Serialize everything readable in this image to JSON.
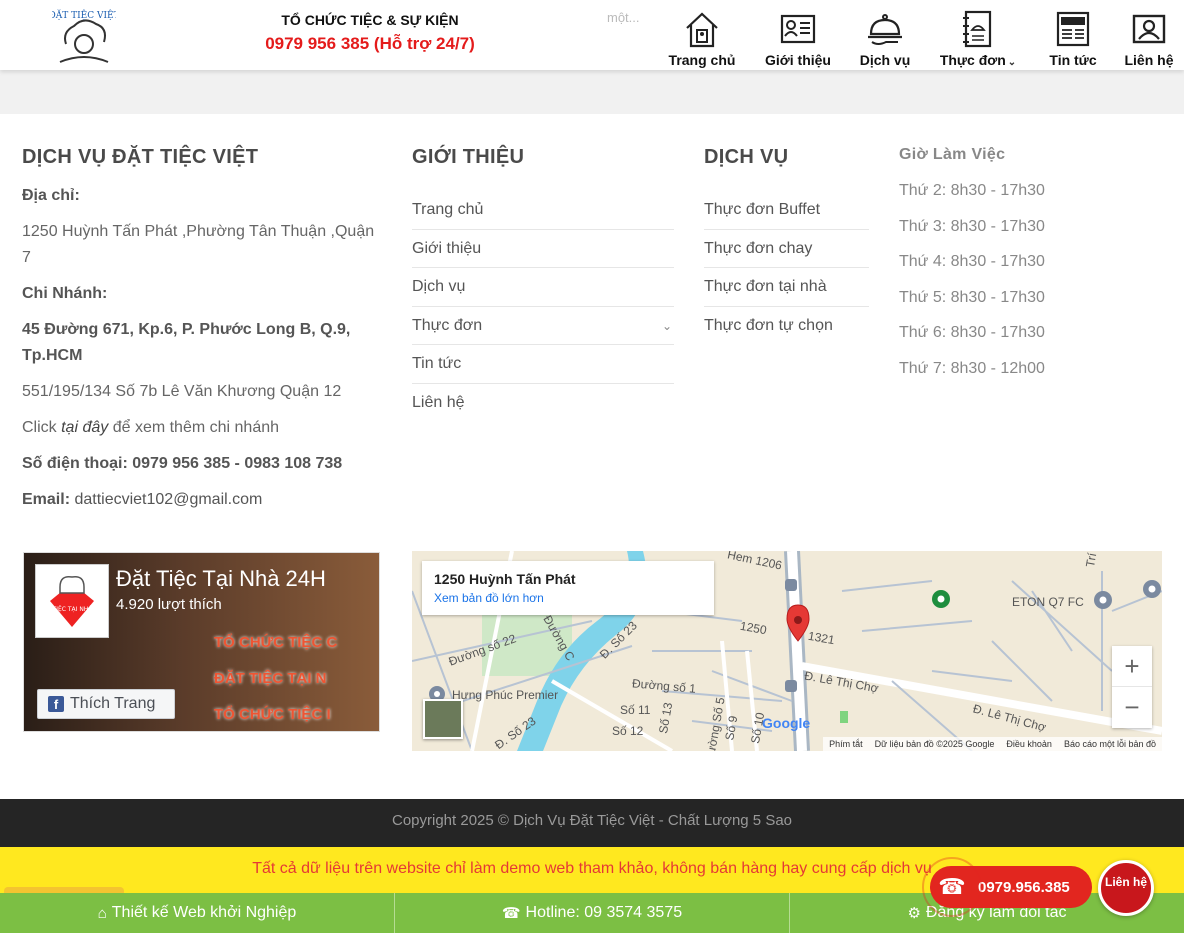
{
  "header": {
    "hotline_title": "TỔ CHỨC TIỆC & SỰ KIỆN",
    "hotline_phone": "0979 956 385 (Hỗ trợ 24/7)",
    "behind_text": "một...",
    "logo_text": "ĐẶT TIỆC VIỆT",
    "nav": [
      {
        "label": "Trang chủ",
        "icon": "home-icon"
      },
      {
        "label": "Giới thiệu",
        "icon": "profile-card-icon"
      },
      {
        "label": "Dịch vụ",
        "icon": "serving-cloche-icon"
      },
      {
        "label": "Thực đơn",
        "icon": "menu-book-icon"
      },
      {
        "label": "Tin tức",
        "icon": "newspaper-icon"
      },
      {
        "label": "Liên hệ",
        "icon": "contact-icon"
      }
    ]
  },
  "footer": {
    "col1": {
      "title": "DỊCH VỤ ĐẶT TIỆC VIỆT",
      "address_label": "Địa chỉ:",
      "address": "1250 Huỳnh Tấn Phát ,Phường Tân Thuận ,Quận 7",
      "branch_label": "Chi Nhánh:",
      "branch_1": "45 Đường 671, Kp.6, P. Phước Long B, Q.9, Tp.HCM",
      "branch_2": "551/195/134 Số 7b Lê Văn Khương  Quận 12",
      "click_pre": "Click ",
      "click_link": "tại đây",
      "click_post": " để xem thêm chi nhánh",
      "phone": "Số điện thoại: 0979 956 385 - 0983 108 738",
      "email_label": "Email:",
      "email": " dattiecviet102@gmail.com"
    },
    "col2": {
      "title": "GIỚI THIỆU",
      "items": [
        "Trang chủ",
        "Giới thiệu",
        "Dịch vụ",
        "Thực đơn",
        "Tin tức",
        "Liên hệ"
      ]
    },
    "col3": {
      "title": "DỊCH VỤ",
      "items": [
        "Thực đơn Buffet",
        "Thực đơn chay",
        "Thực đơn tại nhà",
        "Thực đơn tự chọn"
      ]
    },
    "col4": {
      "title": "Giờ Làm Việc",
      "hours": [
        "Thứ 2: 8h30 - 17h30",
        "Thứ 3: 8h30 - 17h30",
        "Thứ 4: 8h30 - 17h30",
        "Thứ 5: 8h30 - 17h30",
        "Thứ 6: 8h30 - 17h30",
        "Thứ 7: 8h30 - 12h00"
      ]
    }
  },
  "facebook": {
    "page_name": "Đặt Tiệc Tại Nhà 24H",
    "likes": "4.920 lượt thích",
    "like_button": "Thích Trang",
    "banner_lines": [
      "TỔ CHỨC TIỆC C",
      "ĐẶT TIỆC TẠI N",
      "TỔ CHỨC TIỆC I"
    ],
    "thumb_text": "ĐẶT TIỆC TẠI NHÀ 24h"
  },
  "map": {
    "address": "1250 Huỳnh Tấn Phát",
    "link": "Xem bản đồ lớn hơn",
    "zoom_in": "+",
    "zoom_out": "−",
    "google": "Google",
    "labels": [
      "Đường số 22",
      "Đ. Số 23",
      "Đường C",
      "Hưng Phúc Premier",
      "Đường số 1",
      "Đ. Lê Thị Chợ",
      "ETON Q7 FC",
      "1250",
      "1321",
      "Hem 1206",
      "Số 11",
      "Số 12",
      "Đ. Số 23",
      "Số 13",
      "Đường Số 5",
      "Số 9",
      "Số 10",
      "Đ. Lê Thị Chợ",
      "Trí"
    ],
    "footer": [
      "Phím tắt",
      "Dữ liệu bản đồ ©2025 Google",
      "Điều khoản",
      "Báo cáo một lỗi bản đồ"
    ]
  },
  "copyright": "Copyright 2025 © Dịch Vụ Đặt Tiệc Việt - Chất Lượng 5 Sao",
  "demo_notice": "Tất cả dữ liệu trên website chỉ làm demo web tham khảo, không bán hàng hay cung cấp dịch vụ",
  "floating": {
    "call_number": "0979.956.385",
    "chat_label": "Liên hệ"
  },
  "bottom_bar": [
    {
      "label": "Thiết kế Web khởi Nghiệp",
      "icon": "home-icon"
    },
    {
      "label": "Hotline: 09 3574 3575",
      "icon": "phone-icon"
    },
    {
      "label": "Đăng ký làm đối tác",
      "icon": "gear-icon"
    }
  ]
}
